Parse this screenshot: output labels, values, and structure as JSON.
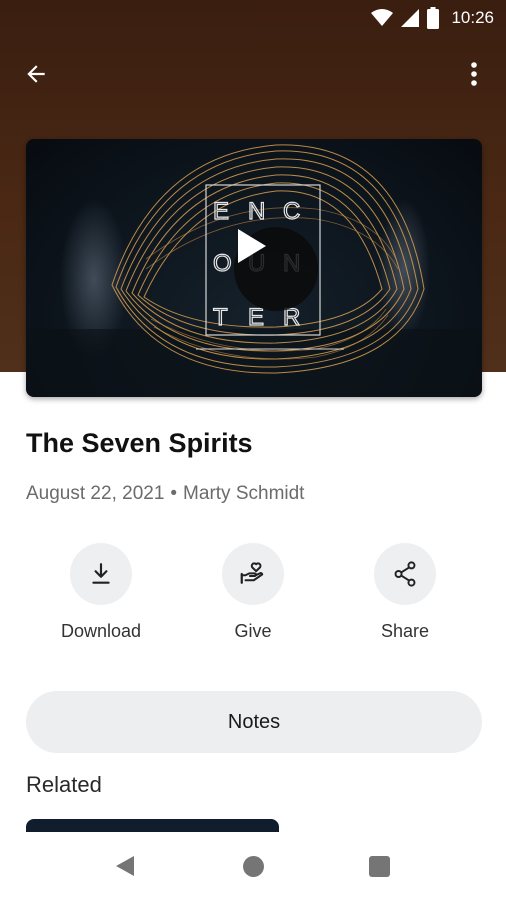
{
  "status_bar": {
    "time": "10:26"
  },
  "video": {
    "artwork_letters": [
      "E",
      "N",
      "C",
      "O",
      "U",
      "N",
      "T",
      "E",
      "R"
    ]
  },
  "sermon": {
    "title": "The Seven Spirits",
    "date": "August 22, 2021",
    "separator": "•",
    "speaker": "Marty Schmidt"
  },
  "actions": {
    "download": "Download",
    "give": "Give",
    "share": "Share"
  },
  "notes_label": "Notes",
  "related_title": "Related",
  "colors": {
    "hero_brown": "#4a2814",
    "chip_gray": "#eeeff1",
    "meta_gray": "#6b6b6b",
    "artwork_gold": "#d9a050"
  },
  "icons": [
    "wifi-icon",
    "signal-icon",
    "battery-icon",
    "back-arrow-icon",
    "more-vert-icon",
    "play-icon",
    "download-icon",
    "give-icon",
    "share-icon",
    "nav-back-icon",
    "nav-home-icon",
    "nav-recents-icon"
  ]
}
